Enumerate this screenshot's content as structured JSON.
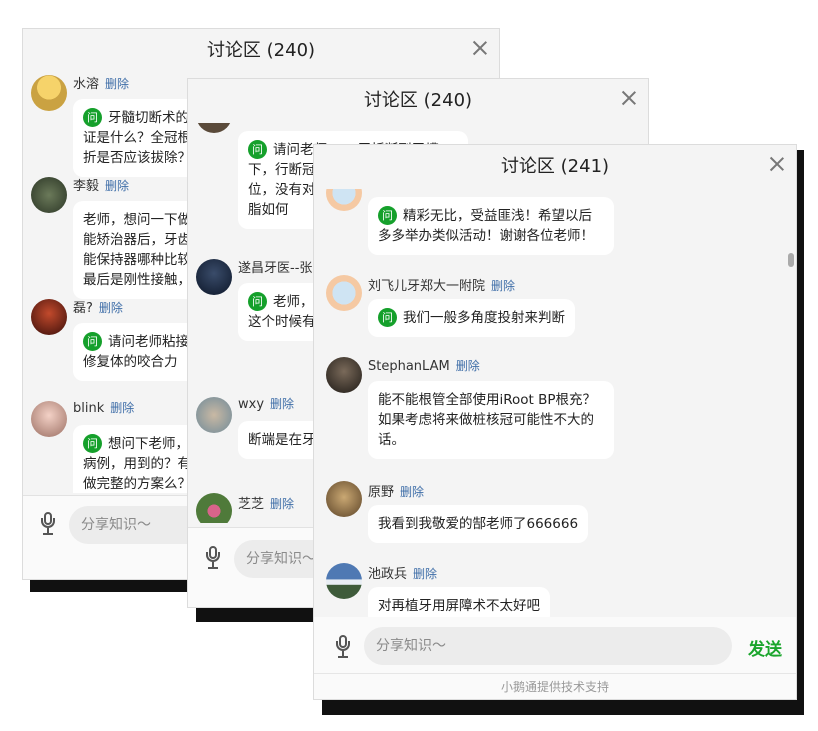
{
  "colors": {
    "accent": "#1aa52c",
    "link": "#3f6ea8",
    "badge": "#15a02b"
  },
  "w1": {
    "title": "讨论区 (240)",
    "msgs": [
      {
        "name": "水溶",
        "del": "删除",
        "text": "牙髓切断术的适应证是什么？全冠根联合折是否应该拔除？",
        "q": true
      },
      {
        "name": "李毅",
        "del": "删除",
        "text": "老师，想问一下做了功能矫治器后，牙齿型功能保持器哪种比较好？最后是刚性接触，固位",
        "q": false
      },
      {
        "name": "磊?",
        "del": "删除",
        "text": "请问老师粘接剂对修复体的咬合力",
        "q": true
      },
      {
        "name": "blink",
        "del": "删除",
        "text": "想问下老师，这个病例，用到的？有没有做完整的方案么？",
        "q": true
      }
    ],
    "input_placeholder": "分享知识～"
  },
  "w2": {
    "title": "讨论区 (240)",
    "msgs": [
      {
        "name": "",
        "del": "",
        "text": "请问老师，11牙折断到牙槽下，行断冠再接，断端不能完整复位，没有对颌的时候，断端用的树脂如何",
        "q": true
      },
      {
        "name": "遂昌牙医--张",
        "del": "",
        "text": "老师，如果断端在龈下，那么这个时候有何技巧，如何处理离？",
        "q": true
      },
      {
        "name": "wxy",
        "del": "删除",
        "text": "断端是在牙槽骨下，无法暴露啊",
        "q": false
      },
      {
        "name": "芝芝",
        "del": "删除",
        "text": "",
        "q": false
      }
    ],
    "input_placeholder": "分享知识～"
  },
  "w3": {
    "title": "讨论区 (241)",
    "msgs": [
      {
        "name": "",
        "del": "",
        "text": "精彩无比，受益匪浅！希望以后多多举办类似活动！谢谢各位老师！",
        "q": true
      },
      {
        "name": "刘飞儿牙郑大一附院",
        "del": "删除",
        "text": "我们一般多角度投射来判断",
        "q": true
      },
      {
        "name": "StephanLAM",
        "del": "删除",
        "text": "能不能根管全部使用iRoot BP根充？如果考虑将来做桩核冠可能性不大的话。",
        "q": false
      },
      {
        "name": "原野",
        "del": "删除",
        "text": "我看到我敬爱的郜老师了666666",
        "q": false
      },
      {
        "name": "池政兵",
        "del": "删除",
        "text": "对再植牙用屏障术不太好吧",
        "q": false
      }
    ],
    "input_placeholder": "分享知识～",
    "send_label": "发送",
    "footer": "小鹅通提供技术支持"
  },
  "q_badge": "问"
}
